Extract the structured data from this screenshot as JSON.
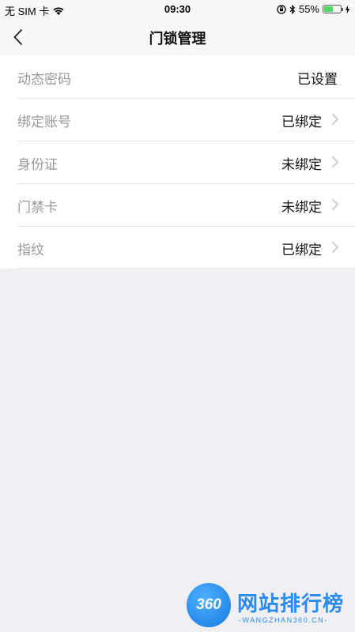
{
  "status_bar": {
    "carrier": "无 SIM 卡",
    "time": "09:30",
    "battery_percent_text": "55%",
    "battery_level": 0.55,
    "icons": [
      "wifi-icon",
      "orientation-lock-icon",
      "bluetooth-icon",
      "battery-icon",
      "charging-icon"
    ]
  },
  "nav": {
    "title": "门锁管理",
    "back_icon": "chevron-left-icon"
  },
  "rows": [
    {
      "label": "动态密码",
      "value": "已设置",
      "chevron": false
    },
    {
      "label": "绑定账号",
      "value": "已绑定",
      "chevron": true
    },
    {
      "label": "身份证",
      "value": "未绑定",
      "chevron": true
    },
    {
      "label": "门禁卡",
      "value": "未绑定",
      "chevron": true
    },
    {
      "label": "指纹",
      "value": "已绑定",
      "chevron": true
    }
  ],
  "watermark": {
    "logo_number": "360",
    "name": "网站排行榜",
    "url": "-WANGZHAN360.CN-"
  },
  "colors": {
    "background": "#efeff4",
    "label_gray": "#999999",
    "battery_green": "#4cd964",
    "watermark_blue": "#2a8cf0"
  }
}
